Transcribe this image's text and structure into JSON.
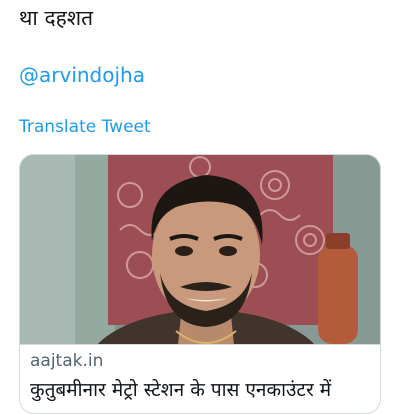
{
  "tweet": {
    "text_line": "था दहशत",
    "mention": "@arvindojha",
    "translate_label": "Translate Tweet"
  },
  "card": {
    "domain": "aajtak.in",
    "headline": "कुतुबमीनार मेट्रो स्टेशन के पास एनकाउंटर में"
  },
  "colors": {
    "link": "#1d9bf0",
    "text": "#14171a",
    "muted": "#536471",
    "border": "#cfd9de"
  }
}
